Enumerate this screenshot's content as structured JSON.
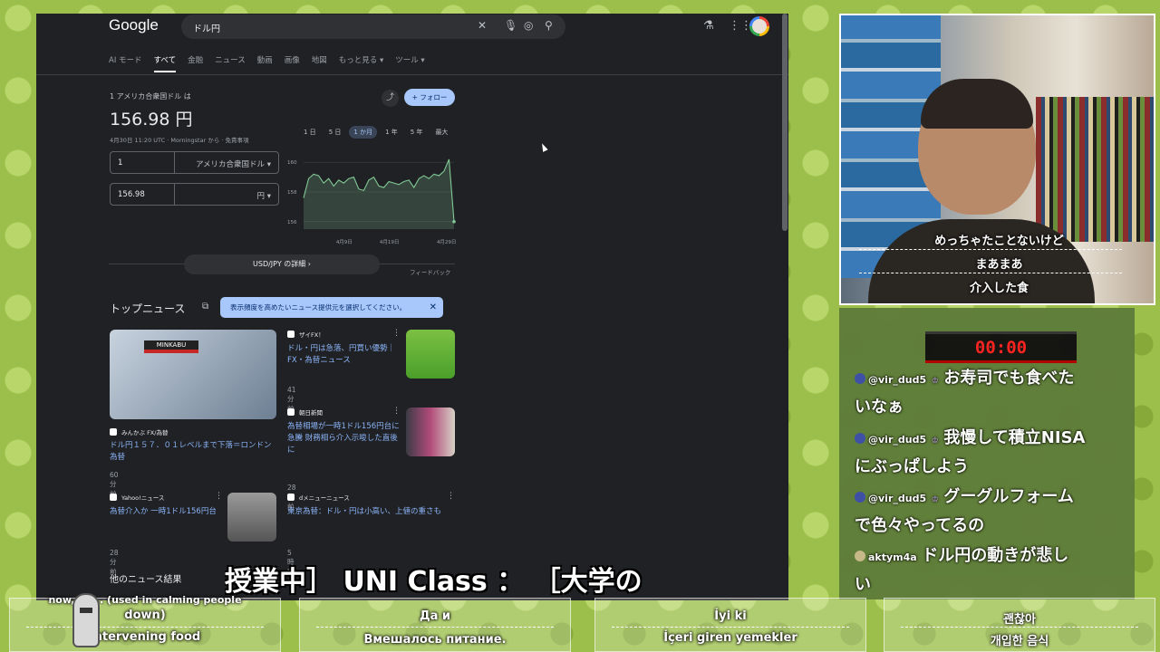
{
  "browser": {
    "logo": "Google",
    "query": "ドル円",
    "tabs": [
      "AI モード",
      "すべて",
      "金融",
      "ニュース",
      "動画",
      "画像",
      "地図",
      "もっと見る ▾",
      "ツール ▾"
    ],
    "active_tab": "すべて"
  },
  "converter": {
    "label": "1 アメリカ合衆国ドル は",
    "value": "156.98 円",
    "meta": "4月30日 11:20 UTC · Morningstar から · 免責事項",
    "follow": "+ フォロー",
    "ranges": [
      "1 日",
      "5 日",
      "1 か月",
      "1 年",
      "5 年",
      "最大"
    ],
    "active_range": "1 か月",
    "from_amount": "1",
    "from_unit": "アメリカ合衆国ドル ▾",
    "to_amount": "156.98",
    "to_unit": "円 ▾",
    "detail_button": "USD/JPY の詳細  ›",
    "feedback": "フィードバック"
  },
  "chart_data": {
    "type": "area",
    "x_ticks": [
      "4月9日",
      "4月19日",
      "4月29日"
    ],
    "y_ticks": [
      "160",
      "158",
      "156"
    ],
    "ylim": [
      155.5,
      160.5
    ],
    "values": [
      157.6,
      158.9,
      159.2,
      159.1,
      158.6,
      158.9,
      158.4,
      158.8,
      158.6,
      158.9,
      159.0,
      158.2,
      158.1,
      158.8,
      159.0,
      158.4,
      158.3,
      158.7,
      158.6,
      158.5,
      158.7,
      158.8,
      158.3,
      158.9,
      159.1,
      158.9,
      159.2,
      159.1,
      159.4,
      160.2,
      156.0
    ],
    "color": "#81c995"
  },
  "news": {
    "title": "トップニュース",
    "tip": "表示頻度を高めたいニュース提供元を選択してください。",
    "cards": [
      {
        "source": "みんかぶ FX/為替",
        "headline": "ドル円１５７．０１レベルまで下落＝ロンドン為替",
        "time": "60 分前"
      },
      {
        "source": "ザイFX！",
        "headline": "ドル・円は急落、円買い優勢｜FX・為替ニュース",
        "time": "41 分前"
      },
      {
        "source": "朝日新聞",
        "headline": "為替相場が一時1ドル156円台に急騰 財務相ら介入示唆した直後に",
        "time": "28 分前"
      },
      {
        "source": "Yahoo!ニュース",
        "headline": "為替介入か 一時1ドル156円台",
        "time": "28 分前"
      },
      {
        "source": "dメニューニュース",
        "headline": "東京為替：ドル・円は小高い、上値の重さも",
        "time": "5 時間前"
      }
    ],
    "thumb_text": "MINKABU",
    "more": "他のニュース結果"
  },
  "webcam_subtitles": [
    "めっちゃたことないけど",
    "まあまあ",
    "介入した食"
  ],
  "timer": "00:00",
  "chat": [
    {
      "user": "@vir_dud5",
      "lines": [
        "お寿司でも食べた",
        "いなぁ"
      ]
    },
    {
      "user": "@vir_dud5",
      "lines": [
        "我慢して積立NISA",
        "にぶっぱしよう"
      ]
    },
    {
      "user": "@vir_dud5",
      "lines": [
        "グーグルフォーム",
        "で色々やってるの"
      ]
    },
    {
      "user": "aktym4a",
      "lines": [
        "ドル円の動きが悲し",
        "い"
      ]
    }
  ],
  "overlay_title": "授業中］ UNI Class ： ［大学の",
  "bottom_subs": [
    [
      "now, no... (used in calming people",
      "down)",
      "Intervening food"
    ],
    [
      "",
      "Да и",
      "Вмешалось питание."
    ],
    [
      "",
      "İyi ki",
      "İçeri giren yemekler"
    ],
    [
      "",
      "괜찮아",
      "개입한 음식"
    ]
  ],
  "colors": {
    "page_bg": "#202124",
    "link": "#8ab4f8",
    "accent": "#a8c7fa",
    "chat_bg": "#5f7d3a",
    "timer": "#ff2020"
  }
}
